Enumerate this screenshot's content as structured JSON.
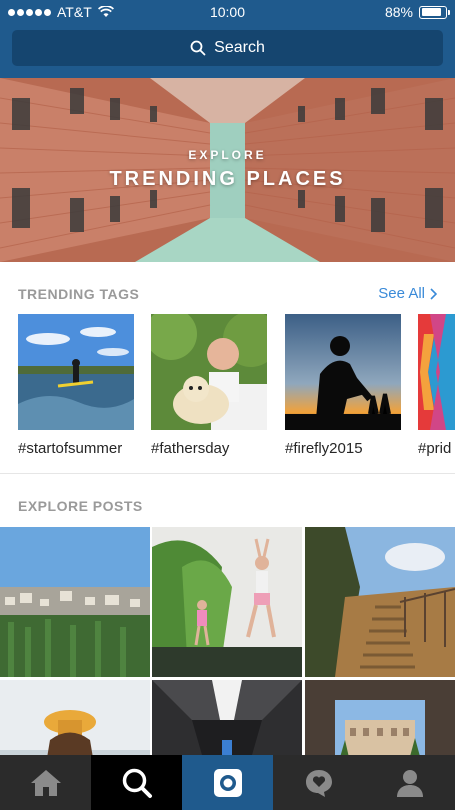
{
  "status_bar": {
    "carrier": "AT&T",
    "time": "10:00",
    "battery": "88%",
    "battery_level": 0.88,
    "signal_bars": 5
  },
  "search": {
    "label": "Search",
    "icon": "search-icon"
  },
  "hero": {
    "subtitle": "EXPLORE",
    "title": "TRENDING PLACES"
  },
  "trending_tags": {
    "title": "TRENDING TAGS",
    "see_all": "See All",
    "items": [
      {
        "tag": "#startofsummer"
      },
      {
        "tag": "#fathersday"
      },
      {
        "tag": "#firefly2015"
      },
      {
        "tag": "#prid"
      }
    ]
  },
  "explore_posts": {
    "title": "EXPLORE POSTS"
  },
  "tab_bar": {
    "items": [
      {
        "icon": "home-icon",
        "selected": false
      },
      {
        "icon": "search-icon",
        "selected": true
      },
      {
        "icon": "camera-icon",
        "selected": false
      },
      {
        "icon": "activity-icon",
        "selected": false
      },
      {
        "icon": "profile-icon",
        "selected": false
      }
    ]
  },
  "colors": {
    "header": "#1f5a8d",
    "search_field": "#15456f",
    "link": "#3a8ad8",
    "section_title": "#9a9a9a",
    "tab_bar": "#2b2b2b"
  }
}
